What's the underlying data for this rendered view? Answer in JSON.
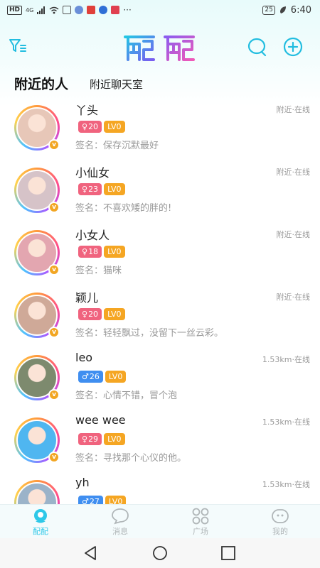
{
  "status_bar": {
    "network": "HD",
    "signal": "4G",
    "battery": "25",
    "time": "6:40"
  },
  "header": {
    "logo_text": "配配",
    "filter_icon": "filter-icon",
    "search_icon": "search-icon",
    "add_icon": "add-icon"
  },
  "tabs": [
    {
      "label": "附近的人",
      "active": true
    },
    {
      "label": "附近聊天室",
      "active": false
    }
  ],
  "users": [
    {
      "name": "丫头",
      "distance": "附近·在线",
      "gender": "♀",
      "age": "20",
      "level": "LV0",
      "sign": "签名：保存沉默最好",
      "avatar_color": "#e7c7b8"
    },
    {
      "name": "小仙女",
      "distance": "附近·在线",
      "gender": "♀",
      "age": "23",
      "level": "LV0",
      "sign": "签名：不喜欢矮的胖的!",
      "avatar_color": "#d6c3c8"
    },
    {
      "name": "小女人",
      "distance": "附近·在线",
      "gender": "♀",
      "age": "18",
      "level": "LV0",
      "sign": "签名：猫咪",
      "avatar_color": "#e3a6b0"
    },
    {
      "name": "颖儿",
      "distance": "附近·在线",
      "gender": "♀",
      "age": "20",
      "level": "LV0",
      "sign": "签名：轻轻飘过，没留下一丝云彩。",
      "avatar_color": "#cfa998"
    },
    {
      "name": "leo",
      "distance": "1.53km·在线",
      "gender": "♂",
      "age": "26",
      "level": "LV0",
      "sign": "签名：心情不错，冒个泡",
      "avatar_color": "#7d8a6e"
    },
    {
      "name": "wee wee",
      "distance": "1.53km·在线",
      "gender": "♀",
      "age": "29",
      "level": "LV0",
      "sign": "签名：寻找那个心仪的他。",
      "avatar_color": "#4fb6f0"
    },
    {
      "name": "yh",
      "distance": "1.53km·在线",
      "gender": "♂",
      "age": "27",
      "level": "LV0",
      "sign": "",
      "avatar_color": "#9bb3c9"
    }
  ],
  "colors": {
    "accent": "#2ec8e8",
    "female": "#f0637e",
    "male": "#3f8ef0",
    "level": "#f5a623"
  },
  "bottom_nav": [
    {
      "label": "配配",
      "icon": "match-icon",
      "active": true
    },
    {
      "label": "消息",
      "icon": "message-icon",
      "active": false
    },
    {
      "label": "广场",
      "icon": "square-icon",
      "active": false
    },
    {
      "label": "我的",
      "icon": "profile-icon",
      "active": false
    }
  ],
  "system_nav": {
    "back_icon": "back-icon",
    "home_icon": "home-icon",
    "recent_icon": "recent-apps-icon"
  }
}
